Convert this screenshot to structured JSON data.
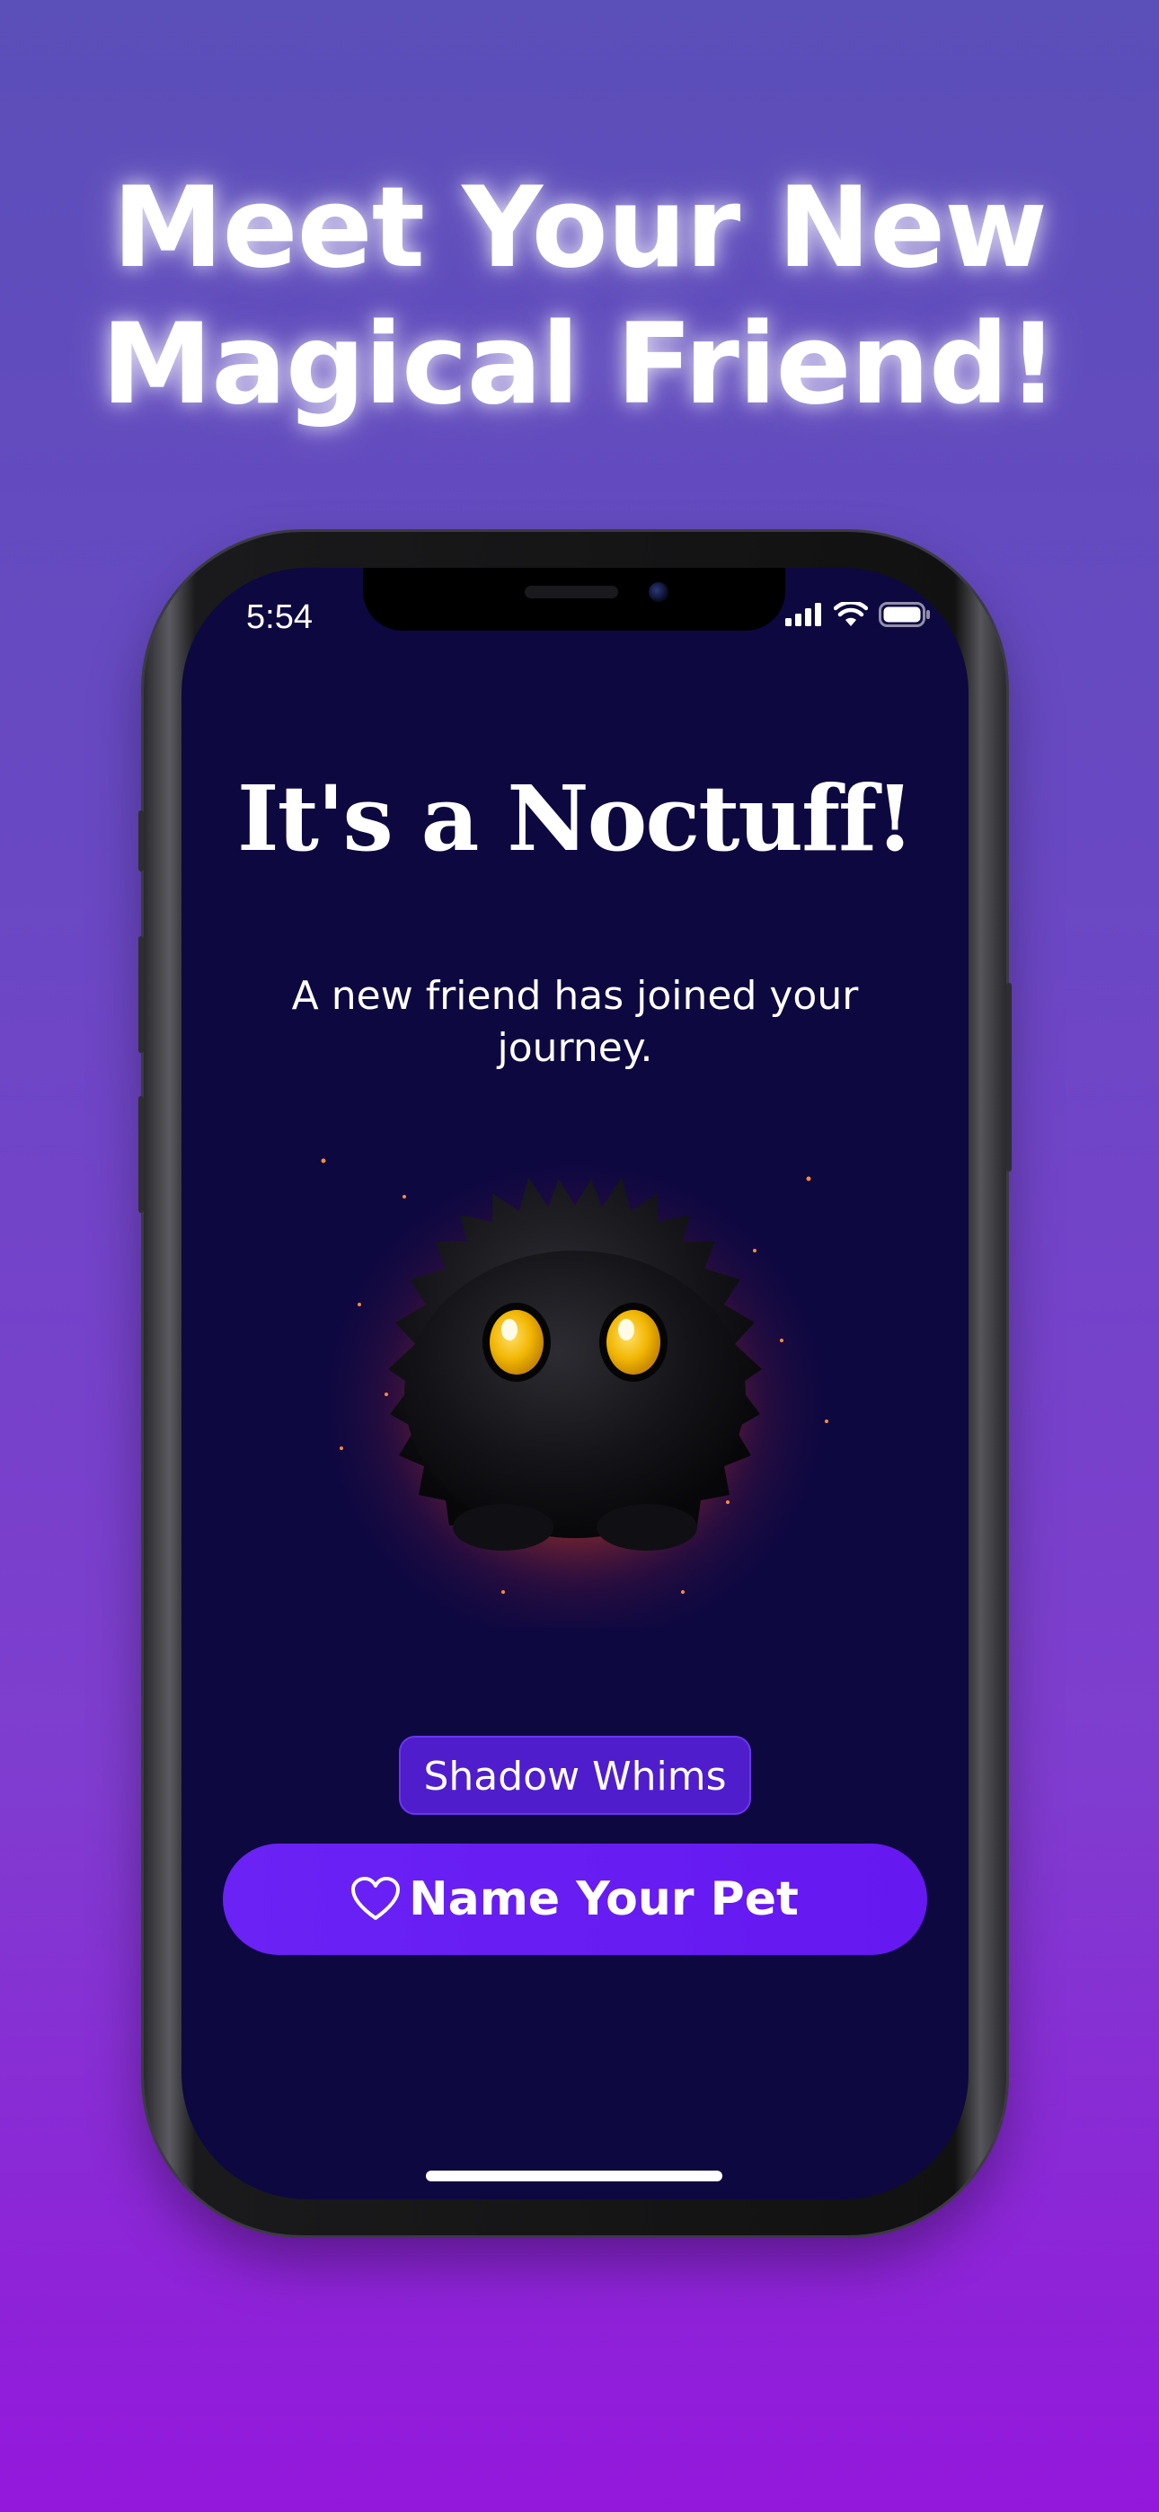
{
  "headline": {
    "line1": "Meet Your New",
    "line2": "Magical Friend!"
  },
  "status_bar": {
    "time": "5:54",
    "icons": [
      "cellular-signal-icon",
      "wifi-icon",
      "battery-icon"
    ]
  },
  "screen": {
    "title": "It's a Noctuff!",
    "subtitle": "A new friend has joined your journey.",
    "pet_image": "black-fluffy-creature-with-yellow-eyes",
    "pet_type_badge": "Shadow Whims",
    "primary_button": {
      "label": "Name Your Pet",
      "icon": "heart-outline-icon"
    }
  },
  "colors": {
    "background_top": "#5b4fb9",
    "background_bottom": "#9418dc",
    "screen_background": "#0d0840",
    "button_accent": "#6a22f5",
    "badge_background": "#4f1dcc",
    "pet_eye": "#f2b705",
    "pet_glow": "#ff5a1f"
  }
}
